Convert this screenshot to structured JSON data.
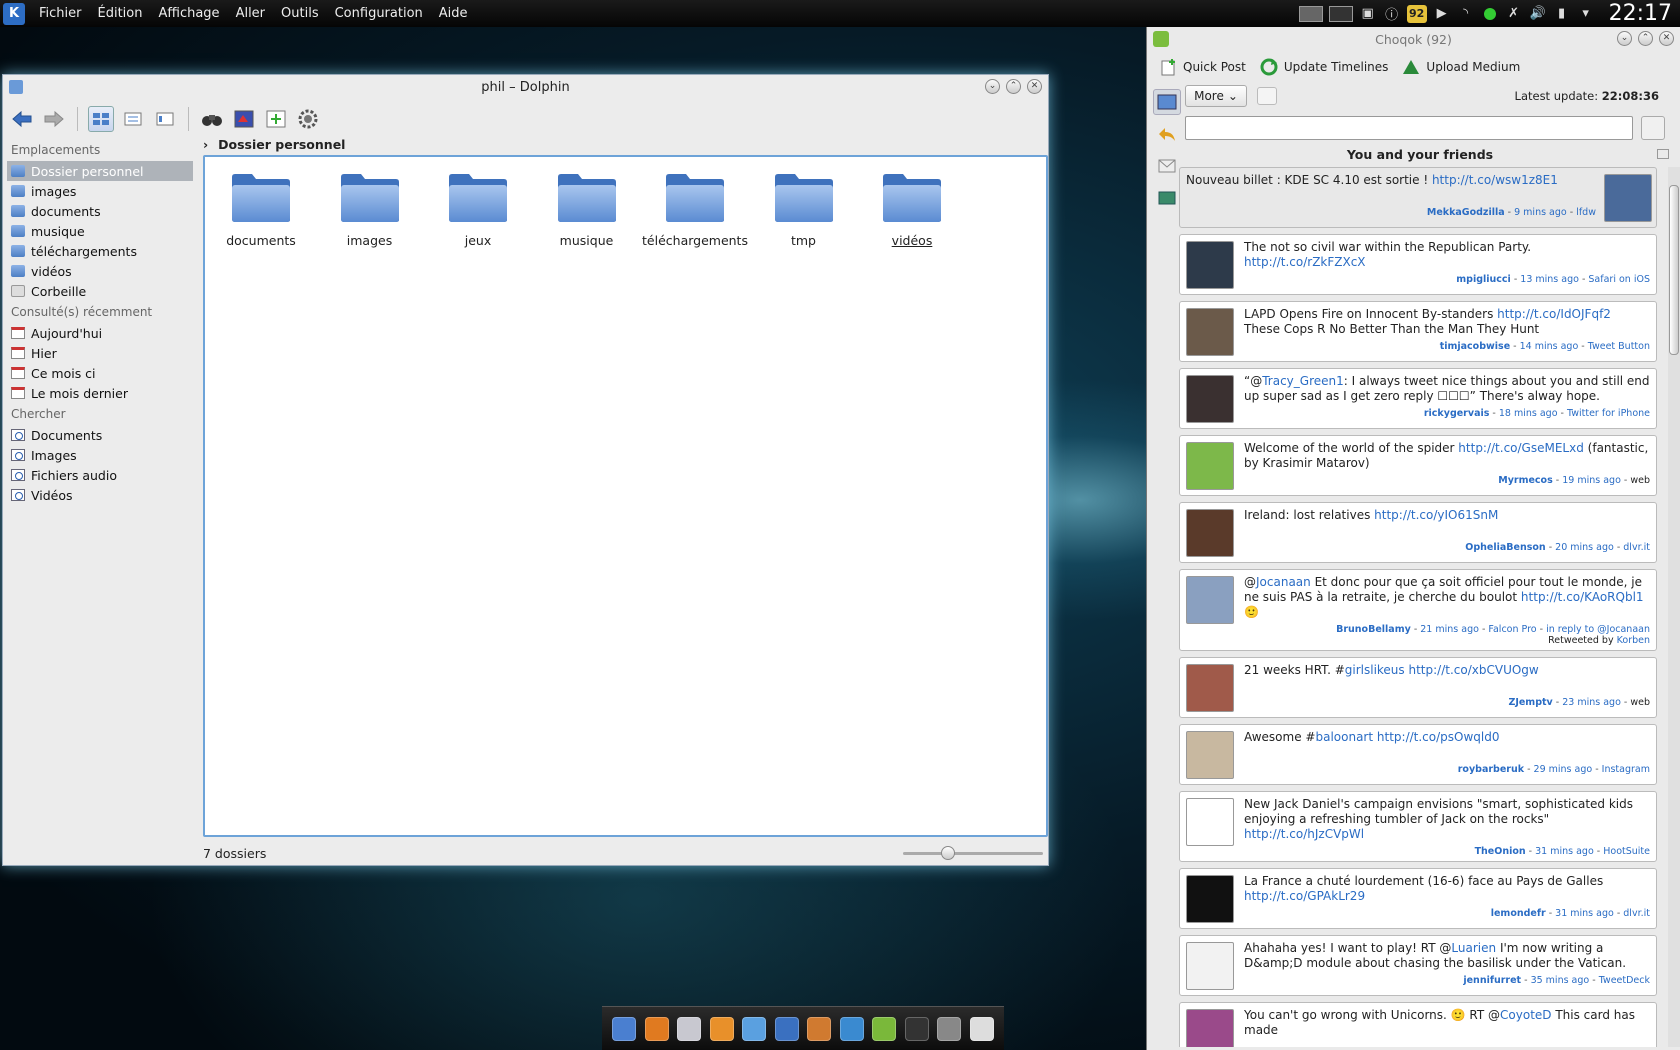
{
  "top_panel": {
    "menus": [
      "Fichier",
      "Édition",
      "Affichage",
      "Aller",
      "Outils",
      "Configuration",
      "Aide"
    ],
    "tray_badge": "92",
    "clock": "22:17"
  },
  "dolphin": {
    "title": "phil – Dolphin",
    "sections": [
      {
        "title": "Emplacements",
        "items": [
          {
            "label": "Dossier personnel",
            "icon": "home-folder-icon",
            "selected": true
          },
          {
            "label": "images",
            "icon": "folder-icon"
          },
          {
            "label": "documents",
            "icon": "folder-icon"
          },
          {
            "label": "musique",
            "icon": "folder-icon"
          },
          {
            "label": "téléchargements",
            "icon": "folder-icon"
          },
          {
            "label": "vidéos",
            "icon": "folder-icon"
          },
          {
            "label": "Corbeille",
            "icon": "trash-icon"
          }
        ]
      },
      {
        "title": "Consulté(s) récemment",
        "items": [
          {
            "label": "Aujourd'hui",
            "icon": "calendar-icon"
          },
          {
            "label": "Hier",
            "icon": "calendar-icon"
          },
          {
            "label": "Ce mois ci",
            "icon": "calendar-icon"
          },
          {
            "label": "Le mois dernier",
            "icon": "calendar-icon"
          }
        ]
      },
      {
        "title": "Chercher",
        "items": [
          {
            "label": "Documents",
            "icon": "search-documents-icon"
          },
          {
            "label": "Images",
            "icon": "search-images-icon"
          },
          {
            "label": "Fichiers audio",
            "icon": "search-audio-icon"
          },
          {
            "label": "Vidéos",
            "icon": "search-videos-icon"
          }
        ]
      }
    ],
    "breadcrumb": "Dossier personnel",
    "folders": [
      "documents",
      "images",
      "jeux",
      "musique",
      "téléchargements",
      "tmp",
      "vidéos"
    ],
    "status": "7 dossiers"
  },
  "choqok": {
    "title": "Choqok (92)",
    "toolbar": {
      "quick_post": "Quick Post",
      "update": "Update Timelines",
      "upload": "Upload Medium"
    },
    "more": "More",
    "latest_label": "Latest update:",
    "latest_time": "22:08:36",
    "timeline_title": "You and your friends",
    "posts": [
      {
        "parts": [
          {
            "t": "Nouveau billet : KDE SC 4.10 est sortie ! "
          },
          {
            "t": "http://t.co/wsw1z8E1",
            "link": true
          }
        ],
        "user": "MekkaGodzilla",
        "time": "9 mins ago",
        "source": "lfdw",
        "avatar": "#4a6a9a"
      },
      {
        "parts": [
          {
            "t": "The not so civil war within the Republican Party. "
          },
          {
            "t": "http://t.co/rZkFZXcX",
            "link": true
          }
        ],
        "user": "mpigliucci",
        "time": "13 mins ago",
        "source": "Safari on iOS",
        "avatar": "#2d3a4a"
      },
      {
        "parts": [
          {
            "t": "LAPD Opens Fire on Innocent By-standers "
          },
          {
            "t": "http://t.co/IdOJFqf2",
            "link": true
          },
          {
            "t": " These Cops R No Better Than the Man They Hunt"
          }
        ],
        "user": "timjacobwise",
        "time": "14 mins ago",
        "source": "Tweet Button",
        "avatar": "#6b5a4a"
      },
      {
        "parts": [
          {
            "t": "“@"
          },
          {
            "t": "Tracy_Green1",
            "link": true
          },
          {
            "t": ": I always tweet nice things about you and still end up super sad as I get zero reply ☐☐☐” There's alway hope."
          }
        ],
        "user": "rickygervais",
        "time": "18 mins ago",
        "source": "Twitter for iPhone",
        "avatar": "#3a3030"
      },
      {
        "parts": [
          {
            "t": "Welcome of the world of the spider "
          },
          {
            "t": "http://t.co/GseMELxd",
            "link": true
          },
          {
            "t": " (fantastic, by Krasimir Matarov)"
          }
        ],
        "user": "Myrmecos",
        "time": "19 mins ago",
        "source": "web",
        "avatar": "#7db84a",
        "plain_source": true
      },
      {
        "parts": [
          {
            "t": "Ireland: lost relatives "
          },
          {
            "t": "http://t.co/yIO61SnM",
            "link": true
          }
        ],
        "user": "OpheliaBenson",
        "time": "20 mins ago",
        "source": "dlvr.it",
        "avatar": "#5a3a2a"
      },
      {
        "parts": [
          {
            "t": "@"
          },
          {
            "t": "Jocanaan",
            "link": true
          },
          {
            "t": " Et donc pour que ça soit officiel pour tout le monde, je ne suis PAS à la retraite, je cherche du boulot "
          },
          {
            "t": "http://t.co/KAoRQbl1",
            "link": true
          },
          {
            "t": " 🙂"
          }
        ],
        "user": "BrunoBellamy",
        "time": "21 mins ago",
        "source": "Falcon Pro",
        "reply": "in reply to @Jocanaan",
        "retweet": "Retweeted by",
        "retweeter": "Korben",
        "avatar": "#8aa0c0"
      },
      {
        "parts": [
          {
            "t": "21 weeks HRT. #"
          },
          {
            "t": "girlslikeus",
            "link": true
          },
          {
            "t": " "
          },
          {
            "t": "http://t.co/xbCVUOgw",
            "link": true
          }
        ],
        "user": "ZJemptv",
        "time": "23 mins ago",
        "source": "web",
        "avatar": "#a05a4a",
        "plain_source": true
      },
      {
        "parts": [
          {
            "t": "Awesome #"
          },
          {
            "t": "baloonart",
            "link": true
          },
          {
            "t": " "
          },
          {
            "t": "http://t.co/psOwqld0",
            "link": true
          }
        ],
        "user": "roybarberuk",
        "time": "29 mins ago",
        "source": "Instagram",
        "avatar": "#c8b8a0"
      },
      {
        "parts": [
          {
            "t": "New Jack Daniel's campaign envisions \"smart, sophisticated kids enjoying a refreshing tumbler of Jack on the rocks\" "
          },
          {
            "t": "http://t.co/hJzCVpWl",
            "link": true
          }
        ],
        "user": "TheOnion",
        "time": "31 mins ago",
        "source": "HootSuite",
        "avatar": "#ffffff"
      },
      {
        "parts": [
          {
            "t": "La France a chuté lourdement (16-6) face au Pays de Galles "
          },
          {
            "t": "http://t.co/GPAkLr29",
            "link": true
          }
        ],
        "user": "lemondefr",
        "time": "31 mins ago",
        "source": "dlvr.it",
        "avatar": "#111111"
      },
      {
        "parts": [
          {
            "t": "Ahahaha yes! I want to play! RT @"
          },
          {
            "t": "Luarien",
            "link": true
          },
          {
            "t": " I'm now writing a D&amp;D module about chasing the basilisk under the Vatican."
          }
        ],
        "user": "jennifurret",
        "time": "35 mins ago",
        "source": "TweetDeck",
        "avatar": "#f2f2f2"
      },
      {
        "parts": [
          {
            "t": "You can't go wrong with Unicorns. 🙂 RT @"
          },
          {
            "t": "CoyoteD",
            "link": true
          },
          {
            "t": " This card has made"
          }
        ],
        "user": "",
        "time": "",
        "source": "",
        "avatar": "#9a4a8a"
      }
    ]
  },
  "taskbar": {
    "apps": [
      {
        "icon": "dolphin-icon",
        "color": "#4a7fd0"
      },
      {
        "icon": "firefox-icon",
        "color": "#e07a20"
      },
      {
        "icon": "mail-icon",
        "color": "#c8c8d0"
      },
      {
        "icon": "rss-icon",
        "color": "#e8902a"
      },
      {
        "icon": "chat-icon",
        "color": "#5aa0e0"
      },
      {
        "icon": "choqok-icon",
        "color": "#3a70c0"
      },
      {
        "icon": "game-icon",
        "color": "#d07a30"
      },
      {
        "icon": "browser-icon",
        "color": "#3a8ad0"
      },
      {
        "icon": "editor-icon",
        "color": "#7ab83a"
      },
      {
        "icon": "terminal-icon",
        "color": "#333333"
      },
      {
        "icon": "tools-icon",
        "color": "#888888"
      },
      {
        "icon": "calculator-icon",
        "color": "#dddddd"
      }
    ]
  }
}
